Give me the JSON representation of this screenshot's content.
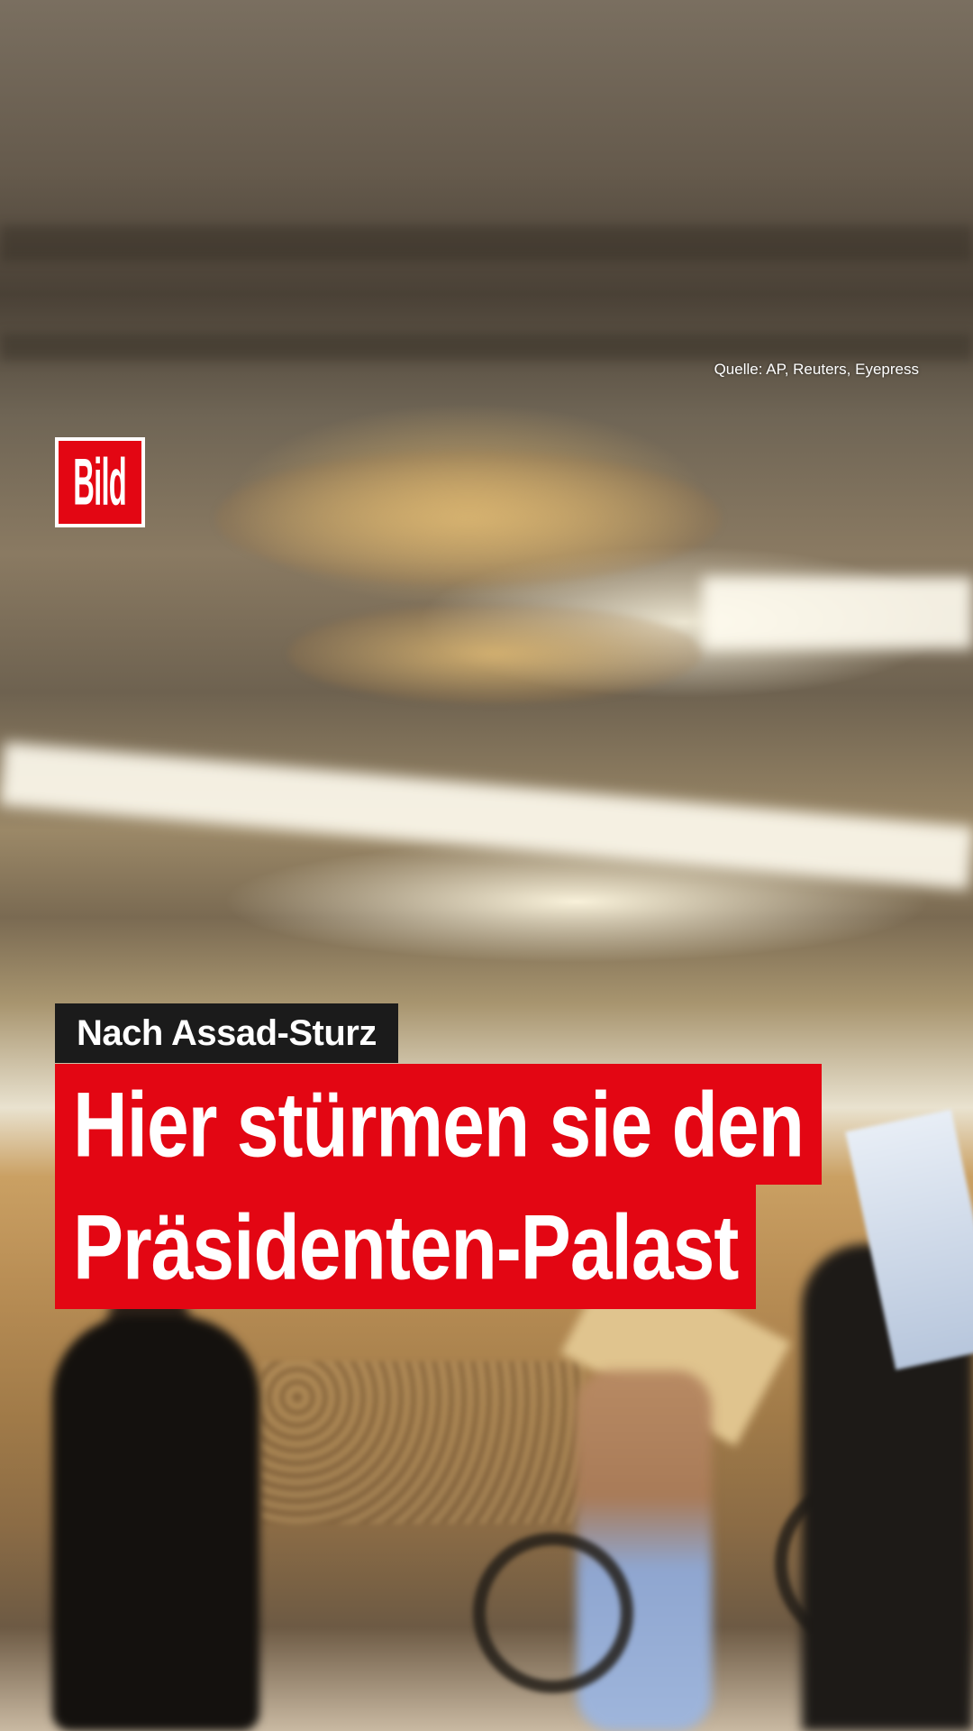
{
  "source_credit": "Quelle: AP, Reuters, Eyepress",
  "logo": {
    "text": "Bild",
    "brand_color": "#e30613"
  },
  "headline": {
    "kicker": "Nach Assad-Sturz",
    "line1": "Hier stürmen sie den",
    "line2": "Präsidenten-Palast"
  },
  "colors": {
    "kicker_background": "#1b1b1b",
    "headline_background": "#e30613",
    "text": "#ffffff"
  }
}
